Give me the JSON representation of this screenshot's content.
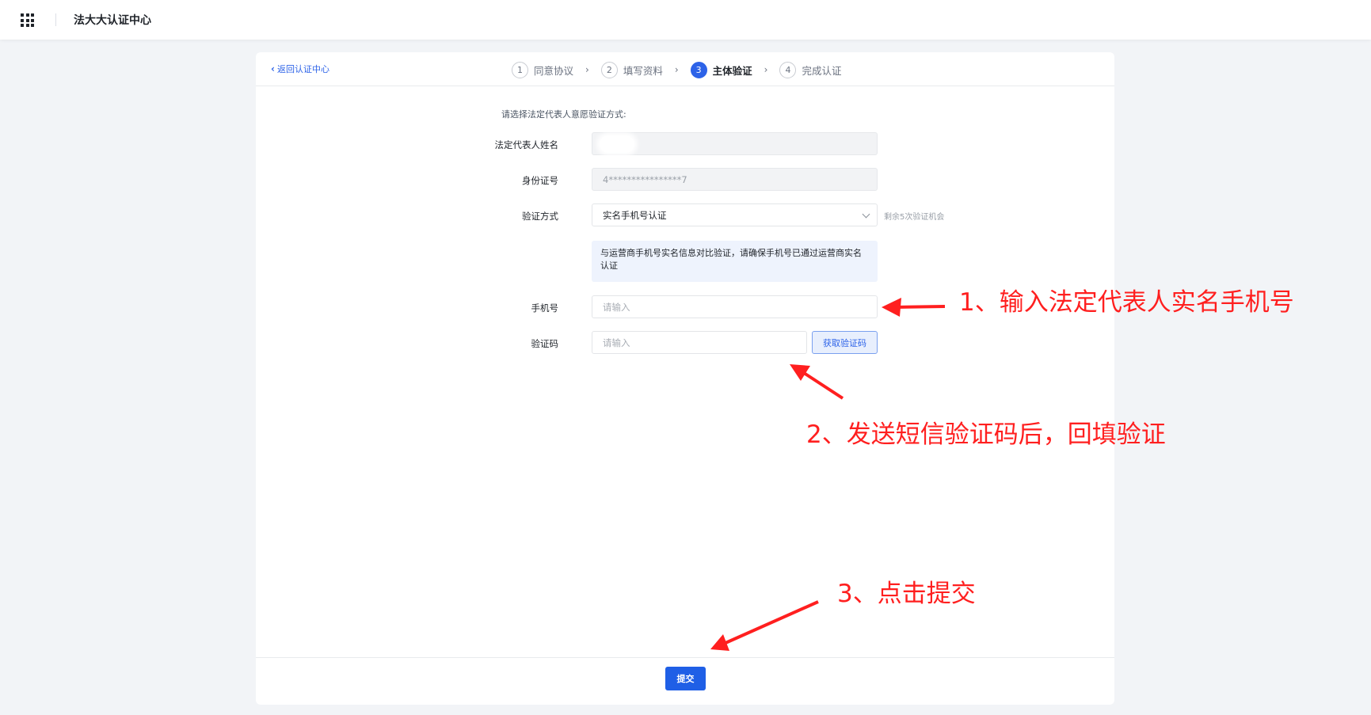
{
  "topbar": {
    "title": "法大大认证中心"
  },
  "header": {
    "back_label": "返回认证中心",
    "steps": [
      {
        "num": "1",
        "label": "同意协议",
        "active": false
      },
      {
        "num": "2",
        "label": "填写资料",
        "active": false
      },
      {
        "num": "3",
        "label": "主体验证",
        "active": true
      },
      {
        "num": "4",
        "label": "完成认证",
        "active": false
      }
    ]
  },
  "form": {
    "hint": "请选择法定代表人意愿验证方式:",
    "name_label": "法定代表人姓名",
    "id_label": "身份证号",
    "id_value": "4****************7",
    "method_label": "验证方式",
    "method_value": "实名手机号认证",
    "chances": "剩余5次验证机会",
    "info": "与运营商手机号实名信息对比验证，请确保手机号已通过运营商实名认证",
    "phone_label": "手机号",
    "phone_placeholder": "请输入",
    "code_label": "验证码",
    "code_placeholder": "请输入",
    "sms_button": "获取验证码"
  },
  "footer": {
    "submit": "提交"
  },
  "annotations": {
    "note1": "1、输入法定代表人实名手机号",
    "note2": "2、发送短信验证码后，回填验证",
    "note3": "3、点击提交",
    "color": "#ff1f1f"
  },
  "colors": {
    "accent": "#2d63e8",
    "page_bg": "#f2f4f7"
  }
}
